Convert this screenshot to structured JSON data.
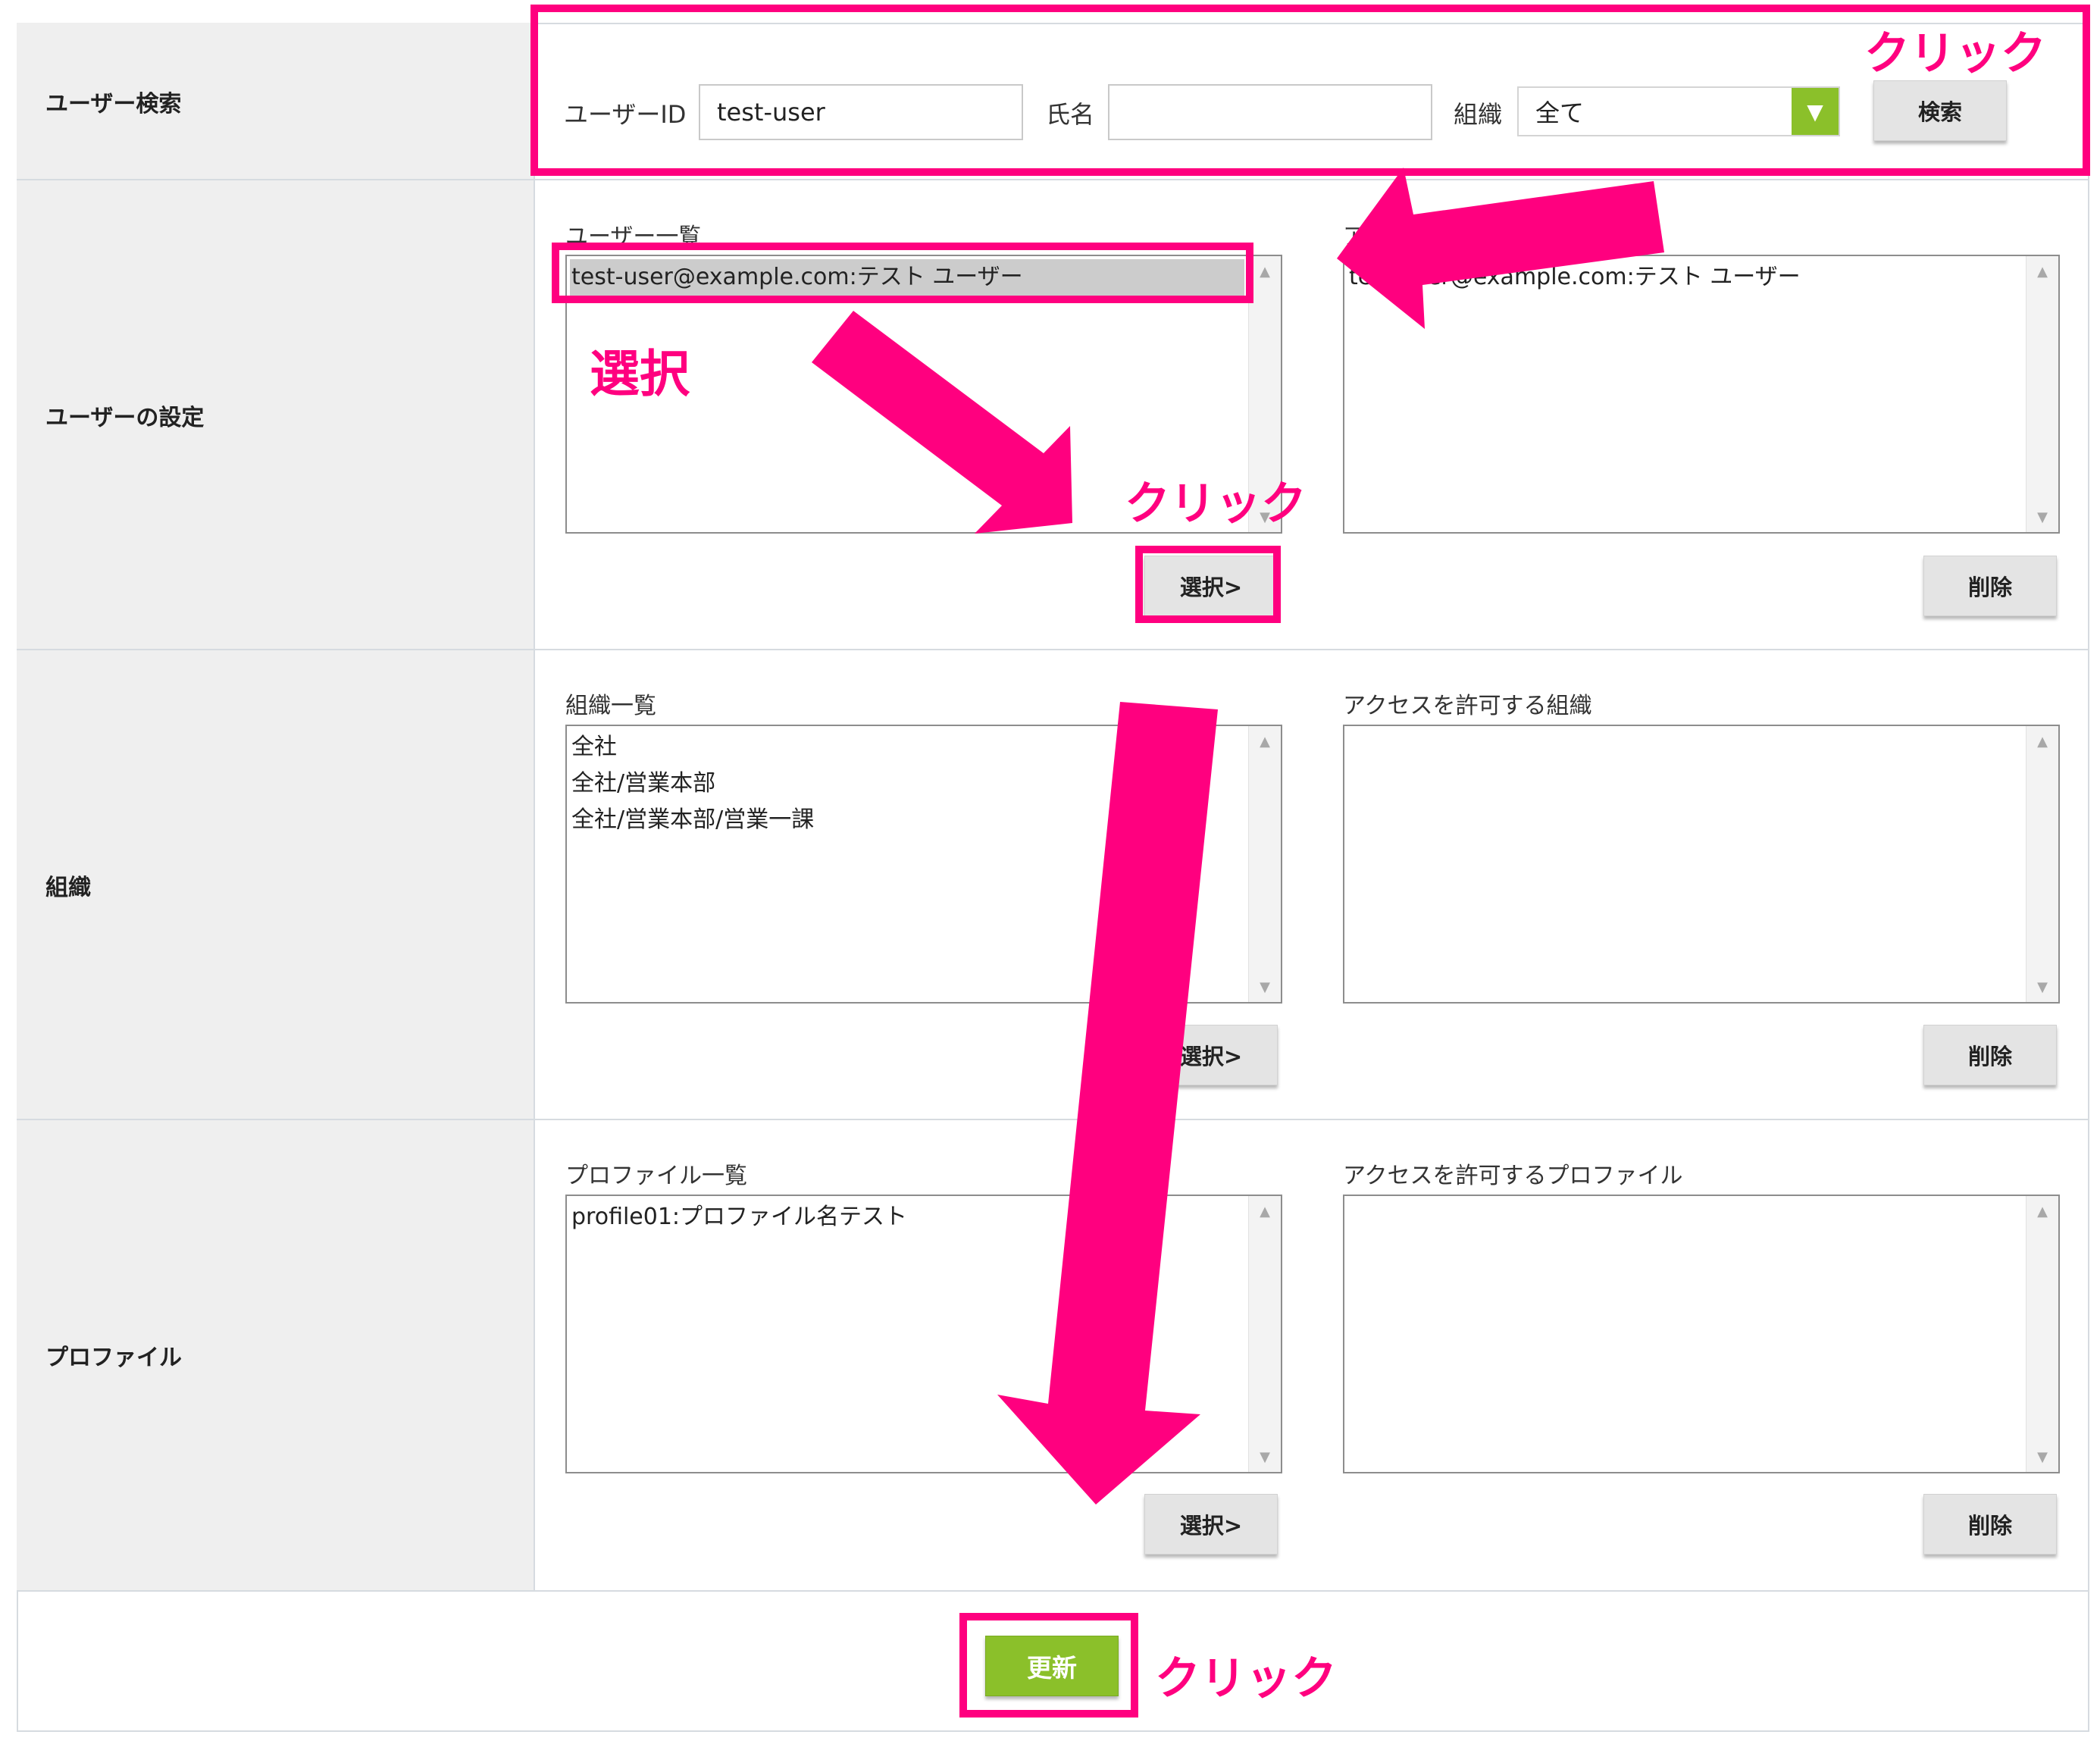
{
  "rows": {
    "search": "ユーザー検索",
    "user_settings": "ユーザーの設定",
    "organization": "組織",
    "profile": "プロファイル"
  },
  "search": {
    "user_id_label": "ユーザーID",
    "user_id_value": "test-user",
    "name_label": "氏名",
    "name_value": "",
    "org_label": "組織",
    "org_selected": "全て",
    "search_button": "検索"
  },
  "users": {
    "list_title": "ユーザー一覧",
    "items": [
      "test-user@example.com:テスト ユーザー"
    ],
    "selected_index": 0,
    "allowed_list_title": "ア",
    "allowed_items": [
      "test-user@example.com:テスト ユーザー"
    ],
    "select_button": "選択>",
    "delete_button": "削除"
  },
  "organizations": {
    "list_title": "組織一覧",
    "items": [
      "全社",
      "全社/営業本部",
      "全社/営業本部/営業一課"
    ],
    "allowed_list_title": "アクセスを許可する組織",
    "allowed_items": [],
    "select_button": "選択>",
    "delete_button": "削除"
  },
  "profiles": {
    "list_title": "プロファイル一覧",
    "items": [
      "profile01:プロファイル名テスト"
    ],
    "allowed_list_title": "アクセスを許可するプロファイル",
    "allowed_items": [],
    "select_button": "選択>",
    "delete_button": "削除"
  },
  "footer": {
    "update_button": "更新"
  },
  "annotations": {
    "click_search": "クリック",
    "select_user": "選択",
    "click_select": "クリック",
    "click_update": "クリック",
    "color": "#ff007f"
  },
  "colors": {
    "accent_green": "#8bc02a",
    "label_bg": "#efefef",
    "border": "#d6dbe0"
  },
  "icons": {
    "select_arrow": "chevron-down-icon",
    "scroll_up": "scroll-up-arrow-icon",
    "scroll_down": "scroll-down-arrow-icon"
  }
}
